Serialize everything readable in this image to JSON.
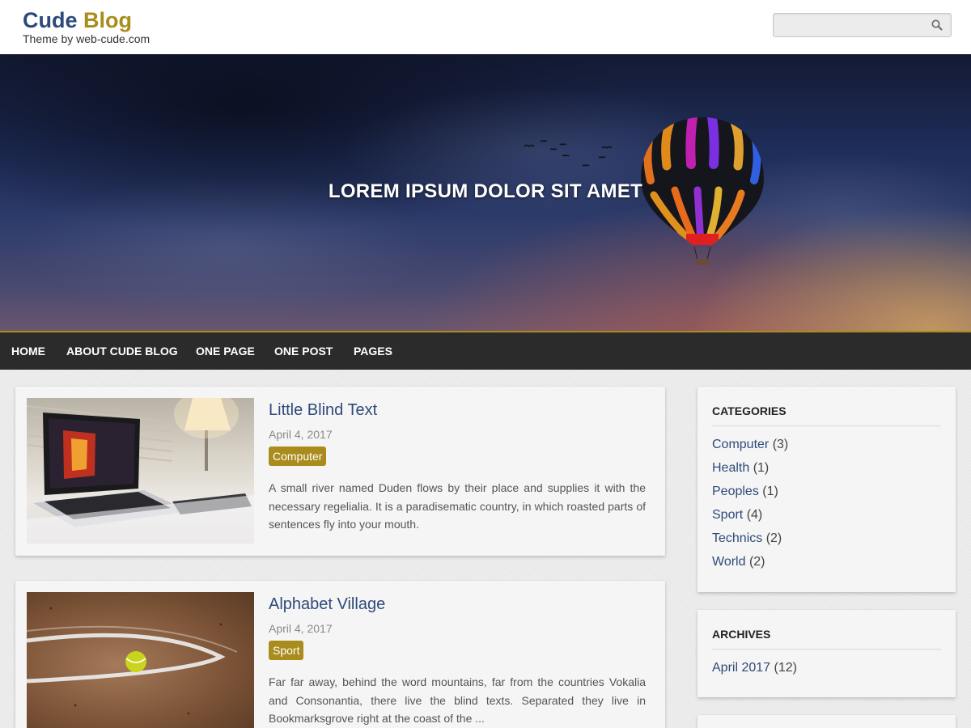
{
  "header": {
    "title_part1": "Cude",
    "title_part2": "Blog",
    "tagline": "Theme by web-cude.com",
    "search_placeholder": "",
    "search_value": ""
  },
  "hero": {
    "title": "LOREM IPSUM DOLOR SIT AMET"
  },
  "nav": {
    "items": [
      {
        "label": "HOME"
      },
      {
        "label": "ABOUT CUDE BLOG"
      },
      {
        "label": "ONE PAGE"
      },
      {
        "label": "ONE POST"
      },
      {
        "label": "PAGES"
      }
    ]
  },
  "posts": [
    {
      "title": "Little Blind Text",
      "date": "April 4, 2017",
      "category": "Computer",
      "excerpt": "A small river named Duden flows by their place and supplies it with the necessary regelialia. It is a paradisematic country, in which roasted parts of sentences fly into your mouth."
    },
    {
      "title": "Alphabet Village",
      "date": "April 4, 2017",
      "category": "Sport",
      "excerpt": "Far far away, behind the word mountains, far from the countries Vokalia and Consonantia, there live the blind texts. Separated they live in Bookmarksgrove right at the coast of the ..."
    }
  ],
  "sidebar": {
    "categories": {
      "title": "CATEGORIES",
      "items": [
        {
          "name": "Computer",
          "count": "(3)"
        },
        {
          "name": "Health",
          "count": "(1)"
        },
        {
          "name": "Peoples",
          "count": "(1)"
        },
        {
          "name": "Sport",
          "count": "(4)"
        },
        {
          "name": "Technics",
          "count": "(2)"
        },
        {
          "name": "World",
          "count": "(2)"
        }
      ]
    },
    "archives": {
      "title": "ARCHIVES",
      "items": [
        {
          "name": "April 2017",
          "count": "(12)"
        }
      ]
    }
  },
  "colors": {
    "brand_blue": "#2e4a7a",
    "brand_gold": "#a98c1c",
    "nav_bg": "#2b2b2b"
  }
}
